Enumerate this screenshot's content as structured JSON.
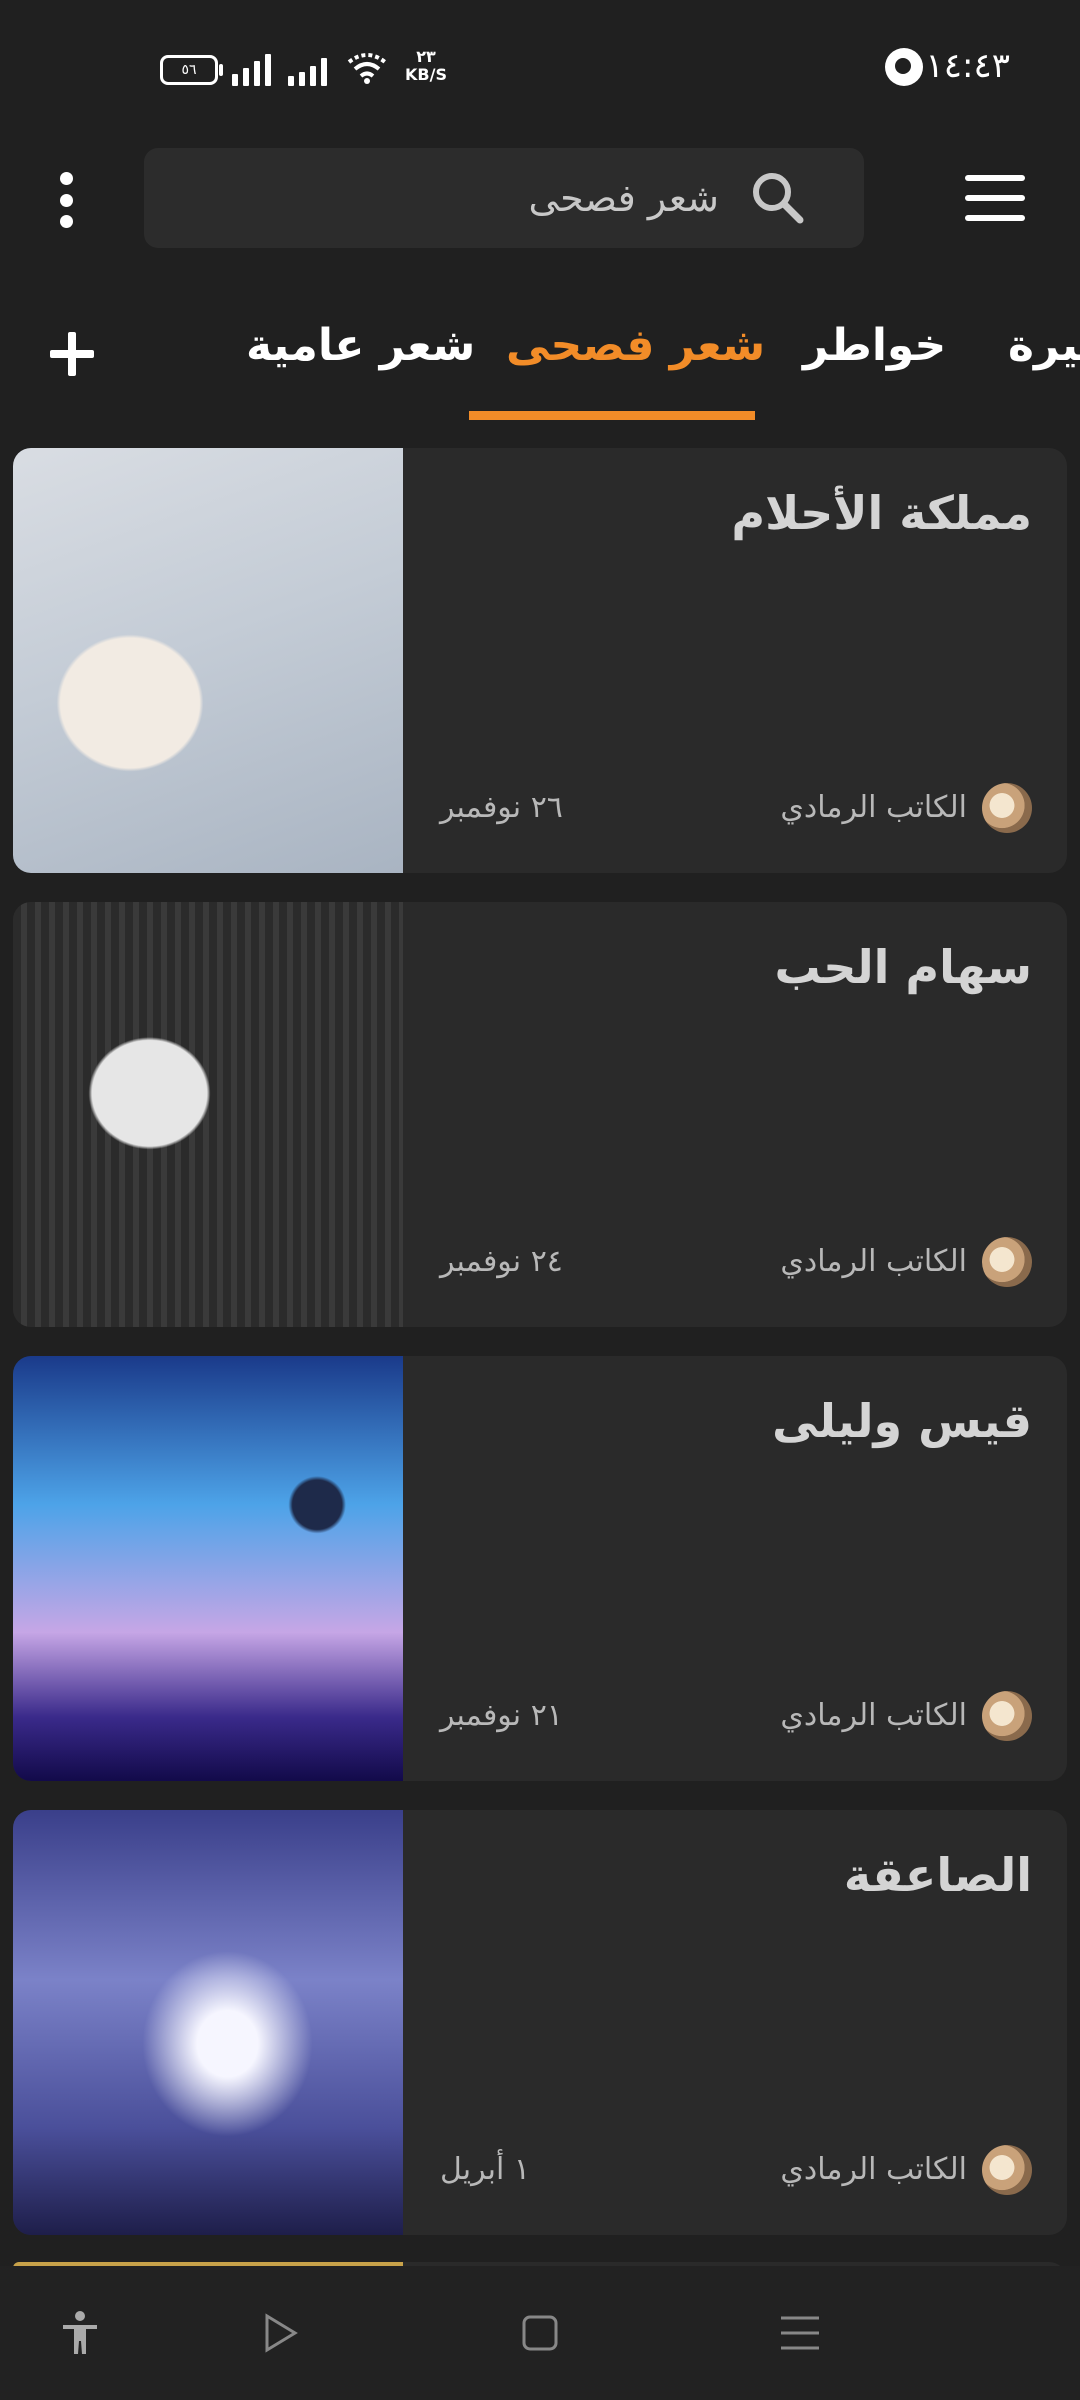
{
  "status_bar": {
    "time": "١٤:٤٣",
    "battery": "٥٦",
    "net_speed_value": "٢٣",
    "net_speed_unit": "KB/S"
  },
  "search": {
    "query": "شعر فصحى"
  },
  "tabs": [
    {
      "label": "سيرة",
      "active": false
    },
    {
      "label": "خواطر",
      "active": false
    },
    {
      "label": "شعر فصحى",
      "active": true
    },
    {
      "label": "شعر عامية",
      "active": false
    }
  ],
  "cards": [
    {
      "title": "مملكة الأحلام",
      "author": "الكاتب الرمادي",
      "date": "٢٦ نوفمبر"
    },
    {
      "title": "سهام الحب",
      "author": "الكاتب الرمادي",
      "date": "٢٤ نوفمبر"
    },
    {
      "title": "قيس وليلى",
      "author": "الكاتب الرمادي",
      "date": "٢١ نوفمبر"
    },
    {
      "title": "الصاعقة",
      "author": "الكاتب الرمادي",
      "date": "١ أبريل"
    }
  ],
  "colors": {
    "accent": "#f28c28",
    "background": "#202020",
    "card": "#2a2a2a"
  },
  "icons": {
    "menu": "hamburger-icon",
    "search": "search-icon",
    "more": "more-vertical-icon",
    "add": "plus-icon"
  }
}
